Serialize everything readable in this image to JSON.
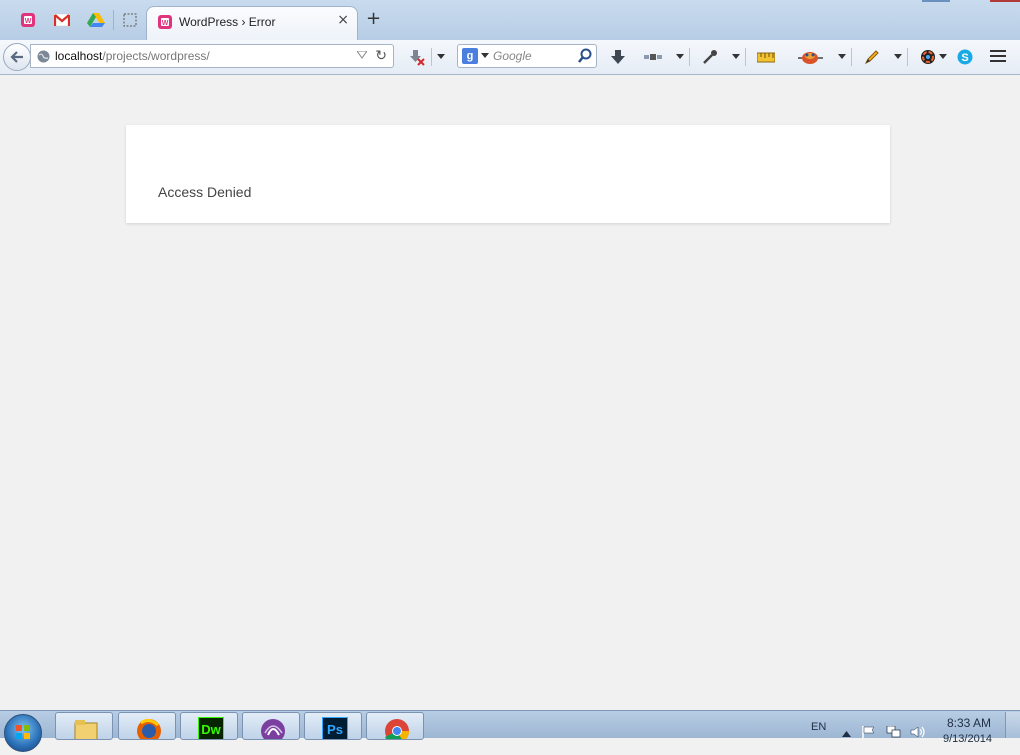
{
  "browser": {
    "pinned_tabs": [
      {
        "icon": "wampserver-icon"
      },
      {
        "icon": "gmail-icon"
      },
      {
        "icon": "google-drive-icon"
      },
      {
        "icon": "blank-tab-icon"
      }
    ],
    "active_tab": {
      "title": "WordPress › Error",
      "icon": "wordpress-error-icon",
      "close_glyph": "×"
    },
    "new_tab_glyph": "+",
    "url": {
      "host": "localhost",
      "path": "/projects/wordpress/"
    },
    "search": {
      "engine_badge": "g",
      "placeholder": "Google"
    },
    "toolbar_icons": [
      "blocked-download-icon",
      "downloads-icon",
      "satellite-icon",
      "eyedropper-icon",
      "ruler-icon",
      "firebug-icon",
      "pencil-icon",
      "color-wheel-icon",
      "skype-icon",
      "menu-icon"
    ]
  },
  "page": {
    "message": "Access Denied"
  },
  "taskbar": {
    "apps": [
      {
        "name": "windows-explorer",
        "icon": "folder-icon"
      },
      {
        "name": "firefox",
        "icon": "firefox-icon"
      },
      {
        "name": "dreamweaver",
        "icon": "dreamweaver-icon",
        "label": "Dw"
      },
      {
        "name": "torrent",
        "icon": "torrent-icon"
      },
      {
        "name": "photoshop",
        "icon": "photoshop-icon",
        "label": "Ps"
      },
      {
        "name": "chrome",
        "icon": "chrome-icon"
      }
    ],
    "language": "EN",
    "time": "8:33 AM",
    "date": "9/13/2014"
  },
  "colors": {
    "wordpress_pink": "#e0357d",
    "page_bg": "#f1f1f1",
    "card_bg": "#ffffff",
    "text": "#444444"
  }
}
